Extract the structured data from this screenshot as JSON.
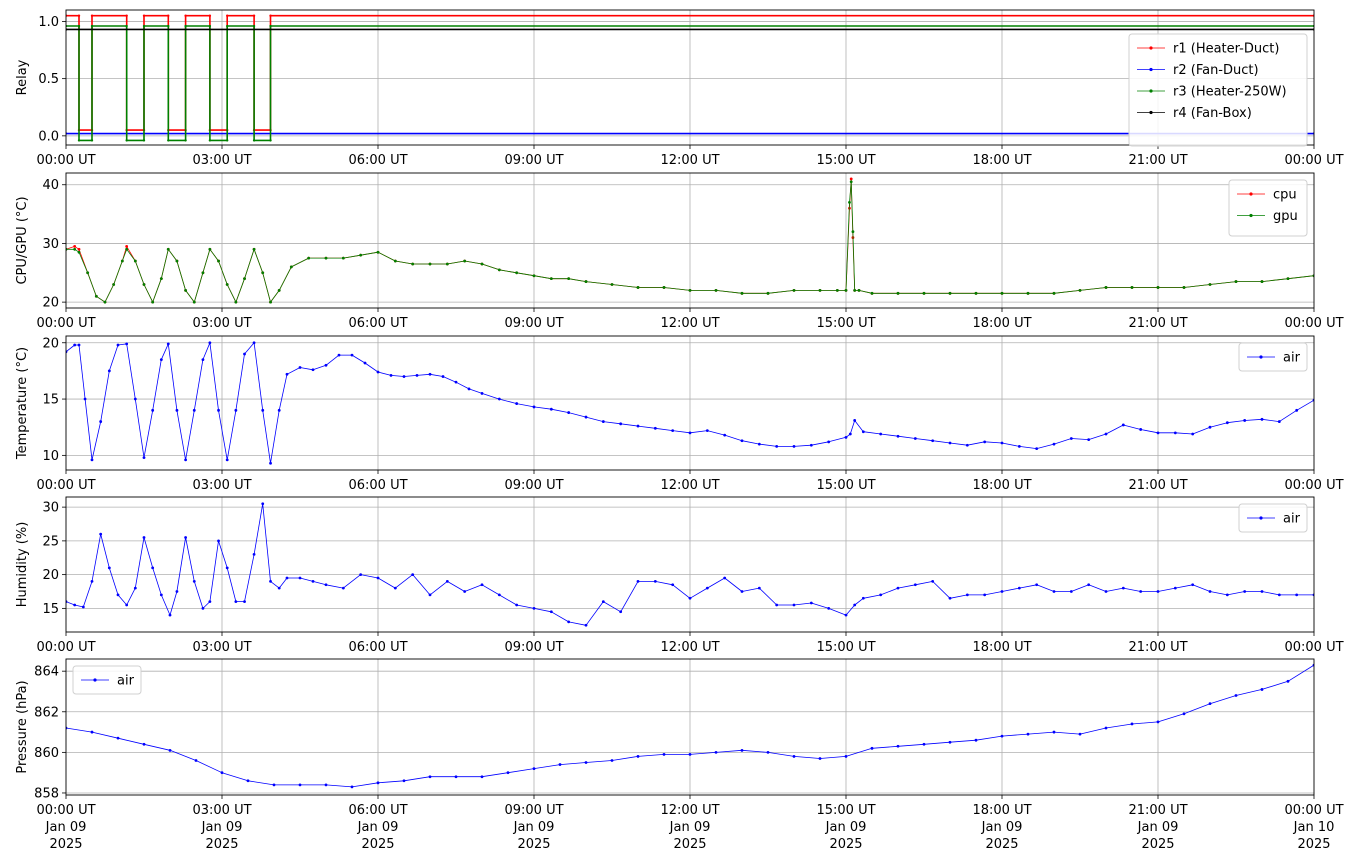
{
  "chart_data": [
    {
      "type": "line",
      "ylabel": "Relay",
      "x_range": [
        "00:00",
        "24:00"
      ],
      "x_ticks": [
        "00:00 UT",
        "03:00 UT",
        "06:00 UT",
        "09:00 UT",
        "12:00 UT",
        "15:00 UT",
        "18:00 UT",
        "21:00 UT",
        "00:00 UT"
      ],
      "ylim": [
        -0.08,
        1.1
      ],
      "y_ticks": [
        "0.0",
        "0.5",
        "1.0"
      ],
      "y_tick_values": [
        0,
        0.5,
        1.0
      ],
      "grid": true,
      "legend": "right",
      "series": [
        {
          "name": "r1 (Heater-Duct)",
          "color": "#ff0000",
          "offset": 0.05,
          "x": [
            "00:00",
            "00:15",
            "00:15",
            "00:30",
            "00:30",
            "01:10",
            "01:10",
            "01:30",
            "01:30",
            "01:58",
            "01:58",
            "02:18",
            "02:18",
            "02:46",
            "02:46",
            "03:06",
            "03:06",
            "03:37",
            "03:37",
            "03:56",
            "03:56",
            "24:00"
          ],
          "values": [
            1,
            1,
            0,
            0,
            1,
            1,
            0,
            0,
            1,
            1,
            0,
            0,
            1,
            1,
            0,
            0,
            1,
            1,
            0,
            0,
            1,
            1
          ]
        },
        {
          "name": "r2 (Fan-Duct)",
          "color": "#0000ff",
          "offset": 0.02,
          "x": [
            "00:00",
            "24:00"
          ],
          "values": [
            0,
            0
          ]
        },
        {
          "name": "r3 (Heater-250W)",
          "color": "#008000",
          "offset": -0.04,
          "x": [
            "00:00",
            "00:15",
            "00:15",
            "00:30",
            "00:30",
            "01:10",
            "01:10",
            "01:30",
            "01:30",
            "01:58",
            "01:58",
            "02:18",
            "02:18",
            "02:46",
            "02:46",
            "03:06",
            "03:06",
            "03:37",
            "03:37",
            "03:56",
            "03:56",
            "24:00"
          ],
          "values": [
            1,
            1,
            0,
            0,
            1,
            1,
            0,
            0,
            1,
            1,
            0,
            0,
            1,
            1,
            0,
            0,
            1,
            1,
            0,
            0,
            1,
            1
          ]
        },
        {
          "name": "r4 (Fan-Box)",
          "color": "#000000",
          "offset": -0.07,
          "x": [
            "00:00",
            "24:00"
          ],
          "values": [
            1,
            1
          ]
        }
      ]
    },
    {
      "type": "line",
      "ylabel": "CPU/GPU (°C)",
      "x_range": [
        "00:00",
        "24:00"
      ],
      "x_ticks": [
        "00:00 UT",
        "03:00 UT",
        "06:00 UT",
        "09:00 UT",
        "12:00 UT",
        "15:00 UT",
        "18:00 UT",
        "21:00 UT",
        "00:00 UT"
      ],
      "ylim": [
        19,
        42
      ],
      "y_ticks": [
        "20",
        "30",
        "40"
      ],
      "y_tick_values": [
        20,
        30,
        40
      ],
      "grid": true,
      "legend": "top-right",
      "x": [
        "00:00",
        "00:10",
        "00:15",
        "00:25",
        "00:35",
        "00:45",
        "00:55",
        "01:05",
        "01:10",
        "01:20",
        "01:30",
        "01:40",
        "01:50",
        "01:58",
        "02:08",
        "02:18",
        "02:28",
        "02:38",
        "02:46",
        "02:56",
        "03:06",
        "03:16",
        "03:26",
        "03:37",
        "03:47",
        "03:56",
        "04:06",
        "04:20",
        "04:40",
        "05:00",
        "05:20",
        "05:40",
        "06:00",
        "06:20",
        "06:40",
        "07:00",
        "07:20",
        "07:40",
        "08:00",
        "08:20",
        "08:40",
        "09:00",
        "09:20",
        "09:40",
        "10:00",
        "10:30",
        "11:00",
        "11:30",
        "12:00",
        "12:30",
        "13:00",
        "13:30",
        "14:00",
        "14:30",
        "14:50",
        "15:00",
        "15:04",
        "15:06",
        "15:08",
        "15:10",
        "15:15",
        "15:30",
        "16:00",
        "16:30",
        "17:00",
        "17:30",
        "18:00",
        "18:30",
        "19:00",
        "19:30",
        "20:00",
        "20:30",
        "21:00",
        "21:30",
        "22:00",
        "22:30",
        "23:00",
        "23:30",
        "24:00"
      ],
      "series": [
        {
          "name": "cpu",
          "color": "#ff0000",
          "values": [
            29,
            29.5,
            29,
            25,
            21,
            20,
            23,
            27,
            29.5,
            27,
            23,
            20,
            24,
            29,
            27,
            22,
            20,
            25,
            29,
            27,
            23,
            20,
            24,
            29,
            25,
            20,
            22,
            26,
            27.5,
            27.5,
            27.5,
            28,
            28.5,
            27,
            26.5,
            26.5,
            26.5,
            27,
            26.5,
            25.5,
            25,
            24.5,
            24,
            24,
            23.5,
            23,
            22.5,
            22.5,
            22,
            22,
            21.5,
            21.5,
            22,
            22,
            22,
            22,
            36,
            41,
            31,
            22,
            22,
            21.5,
            21.5,
            21.5,
            21.5,
            21.5,
            21.5,
            21.5,
            21.5,
            22,
            22.5,
            22.5,
            22.5,
            22.5,
            23,
            23.5,
            23.5,
            24,
            24.5
          ]
        },
        {
          "name": "gpu",
          "color": "#008000",
          "values": [
            29,
            29,
            28.5,
            25,
            21,
            20,
            23,
            27,
            29,
            27,
            23,
            20,
            24,
            29,
            27,
            22,
            20,
            25,
            29,
            27,
            23,
            20,
            24,
            29,
            25,
            20,
            22,
            26,
            27.5,
            27.5,
            27.5,
            28,
            28.5,
            27,
            26.5,
            26.5,
            26.5,
            27,
            26.5,
            25.5,
            25,
            24.5,
            24,
            24,
            23.5,
            23,
            22.5,
            22.5,
            22,
            22,
            21.5,
            21.5,
            22,
            22,
            22,
            22,
            37,
            40.5,
            32,
            22,
            22,
            21.5,
            21.5,
            21.5,
            21.5,
            21.5,
            21.5,
            21.5,
            21.5,
            22,
            22.5,
            22.5,
            22.5,
            22.5,
            23,
            23.5,
            23.5,
            24,
            24.5
          ]
        }
      ]
    },
    {
      "type": "line",
      "ylabel": "Temperature (°C)",
      "x_range": [
        "00:00",
        "24:00"
      ],
      "x_ticks": [
        "00:00 UT",
        "03:00 UT",
        "06:00 UT",
        "09:00 UT",
        "12:00 UT",
        "15:00 UT",
        "18:00 UT",
        "21:00 UT",
        "00:00 UT"
      ],
      "ylim": [
        8.7,
        20.6
      ],
      "y_ticks": [
        "10",
        "15",
        "20"
      ],
      "y_tick_values": [
        10,
        15,
        20
      ],
      "grid": true,
      "legend": "top-right",
      "x": [
        "00:00",
        "00:10",
        "00:15",
        "00:22",
        "00:30",
        "00:40",
        "00:50",
        "01:00",
        "01:10",
        "01:20",
        "01:30",
        "01:40",
        "01:50",
        "01:58",
        "02:08",
        "02:18",
        "02:28",
        "02:38",
        "02:46",
        "02:56",
        "03:06",
        "03:16",
        "03:26",
        "03:37",
        "03:47",
        "03:56",
        "04:06",
        "04:15",
        "04:30",
        "04:45",
        "05:00",
        "05:15",
        "05:30",
        "05:45",
        "06:00",
        "06:15",
        "06:30",
        "06:45",
        "07:00",
        "07:15",
        "07:30",
        "07:45",
        "08:00",
        "08:20",
        "08:40",
        "09:00",
        "09:20",
        "09:40",
        "10:00",
        "10:20",
        "10:40",
        "11:00",
        "11:20",
        "11:40",
        "12:00",
        "12:20",
        "12:40",
        "13:00",
        "13:20",
        "13:40",
        "14:00",
        "14:20",
        "14:40",
        "15:00",
        "15:05",
        "15:10",
        "15:20",
        "15:40",
        "16:00",
        "16:20",
        "16:40",
        "17:00",
        "17:20",
        "17:40",
        "18:00",
        "18:20",
        "18:40",
        "19:00",
        "19:20",
        "19:40",
        "20:00",
        "20:20",
        "20:40",
        "21:00",
        "21:20",
        "21:40",
        "22:00",
        "22:20",
        "22:40",
        "23:00",
        "23:20",
        "23:40",
        "24:00"
      ],
      "series": [
        {
          "name": "air",
          "color": "#0000ff",
          "values": [
            19.2,
            19.8,
            19.8,
            15,
            9.6,
            13,
            17.5,
            19.8,
            19.9,
            15,
            9.8,
            14,
            18.5,
            19.9,
            14,
            9.6,
            14,
            18.5,
            20,
            14,
            9.6,
            14,
            19,
            20,
            14,
            9.3,
            14,
            17.2,
            17.8,
            17.6,
            18,
            18.9,
            18.9,
            18.2,
            17.4,
            17.1,
            17.0,
            17.1,
            17.2,
            17.0,
            16.5,
            15.9,
            15.5,
            15.0,
            14.6,
            14.3,
            14.1,
            13.8,
            13.4,
            13.0,
            12.8,
            12.6,
            12.4,
            12.2,
            12.0,
            12.2,
            11.8,
            11.3,
            11.0,
            10.8,
            10.8,
            10.9,
            11.2,
            11.6,
            11.9,
            13.1,
            12.1,
            11.9,
            11.7,
            11.5,
            11.3,
            11.1,
            10.9,
            11.2,
            11.1,
            10.8,
            10.6,
            11.0,
            11.5,
            11.4,
            11.9,
            12.7,
            12.3,
            12.0,
            12.0,
            11.9,
            12.5,
            12.9,
            13.1,
            13.2,
            13.0,
            14.0,
            14.9
          ]
        }
      ]
    },
    {
      "type": "line",
      "ylabel": "Humidity (%)",
      "x_range": [
        "00:00",
        "24:00"
      ],
      "x_ticks": [
        "00:00 UT",
        "03:00 UT",
        "06:00 UT",
        "09:00 UT",
        "12:00 UT",
        "15:00 UT",
        "18:00 UT",
        "21:00 UT",
        "00:00 UT"
      ],
      "ylim": [
        11.5,
        31.5
      ],
      "y_ticks": [
        "15",
        "20",
        "25",
        "30"
      ],
      "y_tick_values": [
        15,
        20,
        25,
        30
      ],
      "grid": true,
      "legend": "top-right",
      "x": [
        "00:00",
        "00:10",
        "00:20",
        "00:30",
        "00:40",
        "00:50",
        "01:00",
        "01:10",
        "01:20",
        "01:30",
        "01:40",
        "01:50",
        "02:00",
        "02:08",
        "02:18",
        "02:28",
        "02:38",
        "02:46",
        "02:56",
        "03:06",
        "03:16",
        "03:26",
        "03:37",
        "03:47",
        "03:56",
        "04:06",
        "04:15",
        "04:30",
        "04:45",
        "05:00",
        "05:20",
        "05:40",
        "06:00",
        "06:20",
        "06:40",
        "07:00",
        "07:20",
        "07:40",
        "08:00",
        "08:20",
        "08:40",
        "09:00",
        "09:20",
        "09:40",
        "10:00",
        "10:20",
        "10:40",
        "11:00",
        "11:20",
        "11:40",
        "12:00",
        "12:20",
        "12:40",
        "13:00",
        "13:20",
        "13:40",
        "14:00",
        "14:20",
        "14:40",
        "15:00",
        "15:10",
        "15:20",
        "15:40",
        "16:00",
        "16:20",
        "16:40",
        "17:00",
        "17:20",
        "17:40",
        "18:00",
        "18:20",
        "18:40",
        "19:00",
        "19:20",
        "19:40",
        "20:00",
        "20:20",
        "20:40",
        "21:00",
        "21:20",
        "21:40",
        "22:00",
        "22:20",
        "22:40",
        "23:00",
        "23:20",
        "23:40",
        "24:00"
      ],
      "series": [
        {
          "name": "air",
          "color": "#0000ff",
          "values": [
            16,
            15.5,
            15.2,
            19,
            26,
            21,
            17,
            15.5,
            18,
            25.5,
            21,
            17,
            14,
            17.5,
            25.5,
            19,
            15,
            16,
            25,
            21,
            16,
            16,
            23,
            30.5,
            19,
            18,
            19.5,
            19.5,
            19,
            18.5,
            18,
            20,
            19.5,
            18,
            20,
            17,
            19,
            17.5,
            18.5,
            17,
            15.5,
            15,
            14.5,
            13,
            12.5,
            16,
            14.5,
            19,
            19,
            18.5,
            16.5,
            18,
            19.5,
            17.5,
            18,
            15.5,
            15.5,
            15.8,
            15,
            14,
            15.5,
            16.5,
            17,
            18,
            18.5,
            19,
            16.5,
            17,
            17,
            17.5,
            18,
            18.5,
            17.5,
            17.5,
            18.5,
            17.5,
            18,
            17.5,
            17.5,
            18,
            18.5,
            17.5,
            17,
            17.5,
            17.5,
            17,
            17,
            17
          ]
        }
      ]
    },
    {
      "type": "line",
      "ylabel": "Pressure (hPa)",
      "x_range": [
        "00:00",
        "24:00"
      ],
      "x_ticks": [
        "00:00 UT\nJan 09\n2025",
        "03:00 UT\nJan 09\n2025",
        "06:00 UT\nJan 09\n2025",
        "09:00 UT\nJan 09\n2025",
        "12:00 UT\nJan 09\n2025",
        "15:00 UT\nJan 09\n2025",
        "18:00 UT\nJan 09\n2025",
        "21:00 UT\nJan 09\n2025",
        "00:00 UT\nJan 10\n2025"
      ],
      "ylim": [
        857.9,
        864.6
      ],
      "y_ticks": [
        "858",
        "860",
        "862",
        "864"
      ],
      "y_tick_values": [
        858,
        860,
        862,
        864
      ],
      "grid": true,
      "legend": "top-left",
      "x": [
        "00:00",
        "00:30",
        "01:00",
        "01:30",
        "02:00",
        "02:30",
        "03:00",
        "03:30",
        "04:00",
        "04:30",
        "05:00",
        "05:30",
        "06:00",
        "06:30",
        "07:00",
        "07:30",
        "08:00",
        "08:30",
        "09:00",
        "09:30",
        "10:00",
        "10:30",
        "11:00",
        "11:30",
        "12:00",
        "12:30",
        "13:00",
        "13:30",
        "14:00",
        "14:30",
        "15:00",
        "15:30",
        "16:00",
        "16:30",
        "17:00",
        "17:30",
        "18:00",
        "18:30",
        "19:00",
        "19:30",
        "20:00",
        "20:30",
        "21:00",
        "21:30",
        "22:00",
        "22:30",
        "23:00",
        "23:30",
        "24:00"
      ],
      "series": [
        {
          "name": "air",
          "color": "#0000ff",
          "values": [
            861.2,
            861.0,
            860.7,
            860.4,
            860.1,
            859.6,
            859.0,
            858.6,
            858.4,
            858.4,
            858.4,
            858.3,
            858.5,
            858.6,
            858.8,
            858.8,
            858.8,
            859.0,
            859.2,
            859.4,
            859.5,
            859.6,
            859.8,
            859.9,
            859.9,
            860.0,
            860.1,
            860.0,
            859.8,
            859.7,
            859.8,
            860.2,
            860.3,
            860.4,
            860.5,
            860.6,
            860.8,
            860.9,
            861.0,
            860.9,
            861.2,
            861.4,
            861.5,
            861.9,
            862.4,
            862.8,
            863.1,
            863.5,
            864.3
          ]
        }
      ]
    }
  ]
}
